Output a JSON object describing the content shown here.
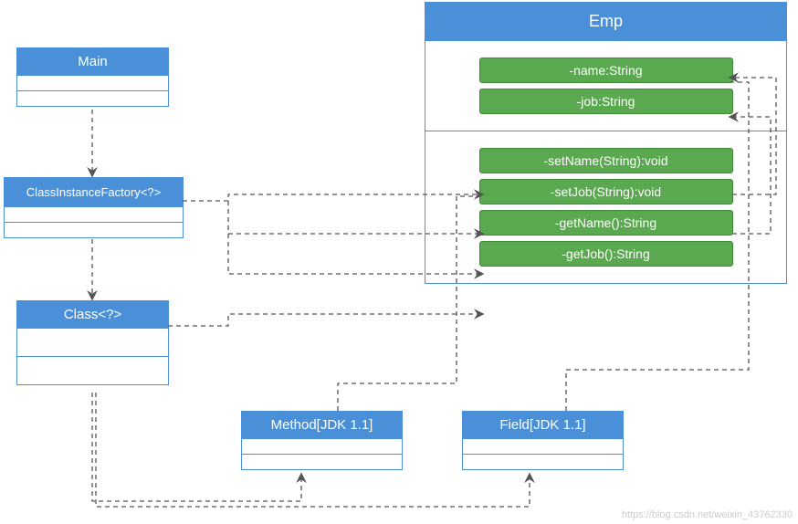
{
  "boxes": {
    "main": "Main",
    "factory": "ClassInstanceFactory<?>",
    "cls": "Class<?>",
    "method": "Method[JDK 1.1]",
    "field": "Field[JDK 1.1]"
  },
  "emp": {
    "title": "Emp",
    "attrs": [
      "-name:String",
      "-job:String"
    ],
    "ops": [
      "-setName(String):void",
      "-setJob(String):void",
      "-getName():String",
      "-getJob():String"
    ]
  },
  "watermark": "https://blog.csdn.net/weixin_43762330"
}
